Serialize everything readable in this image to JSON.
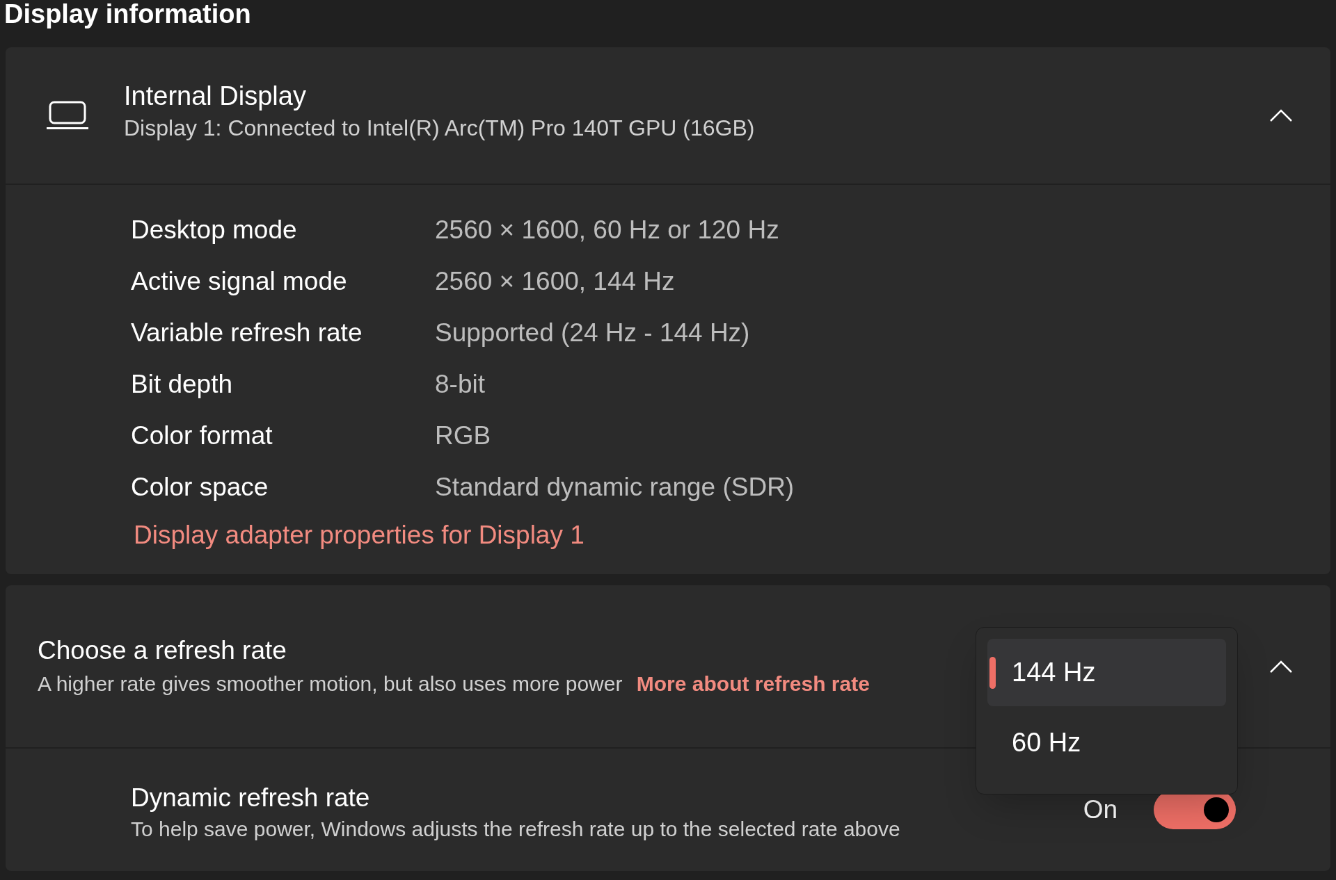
{
  "page_title": "Display information",
  "display": {
    "name": "Internal Display",
    "subtitle": "Display 1: Connected to Intel(R) Arc(TM) Pro 140T GPU (16GB)",
    "expanded": true,
    "properties": [
      {
        "label": "Desktop mode",
        "value": "2560 × 1600, 60 Hz or 120 Hz"
      },
      {
        "label": "Active signal mode",
        "value": "2560 × 1600, 144 Hz"
      },
      {
        "label": "Variable refresh rate",
        "value": "Supported (24 Hz - 144 Hz)"
      },
      {
        "label": "Bit depth",
        "value": "8-bit"
      },
      {
        "label": "Color format",
        "value": "RGB"
      },
      {
        "label": "Color space",
        "value": "Standard dynamic range (SDR)"
      }
    ],
    "link": "Display adapter properties for Display 1"
  },
  "refresh_rate": {
    "title": "Choose a refresh rate",
    "description": "A higher rate gives smoother motion, but also uses more power",
    "link": "More about refresh rate",
    "expanded": true,
    "options": [
      {
        "label": "144 Hz",
        "selected": true
      },
      {
        "label": "60 Hz",
        "selected": false
      }
    ]
  },
  "dynamic_refresh": {
    "title": "Dynamic refresh rate",
    "description": "To help save power, Windows adjusts the refresh rate up to the selected rate above",
    "state_label": "On",
    "on": true
  }
}
